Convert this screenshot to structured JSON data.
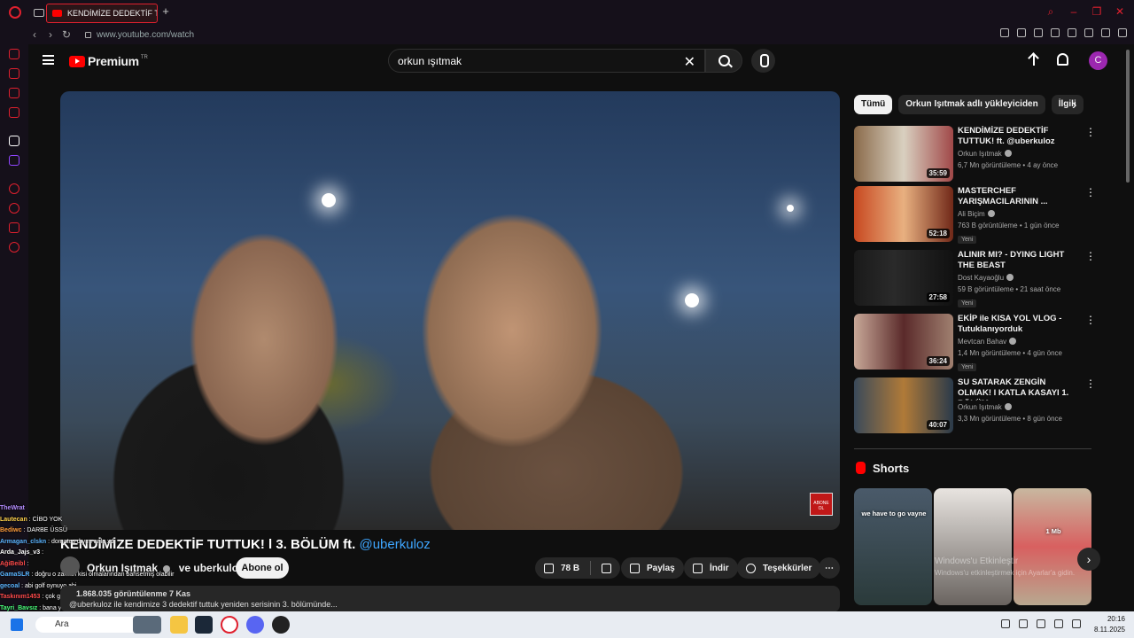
{
  "browser": {
    "tab_title": "KENDİMİZE DEDEKTİF TU",
    "url": "www.youtube.com/watch"
  },
  "header": {
    "logo_text": "Premium",
    "logo_badge": "TR",
    "search_value": "orkun ışıtmak",
    "avatar_letter": "C"
  },
  "video": {
    "title": "KENDİMİZE DEDEKTİF TUTTUK! l 3. BÖLÜM ft.",
    "title_link": "@uberkuloz",
    "channel": "Orkun Işıtmak",
    "channel_collab": "ve uberkuloz",
    "subscribe_label": "Abone ol",
    "likes": "78 B",
    "share_label": "Paylaş",
    "download_label": "İndir",
    "thanks_label": "Teşekkürler",
    "views_line": "1.868.035 görüntülenme  7 Kas",
    "description": "@uberkuloz ile kendimize 3 dedektif tuttuk yeniden serisinin 3. bölümünde..."
  },
  "chat": [
    {
      "user": "TheWrat",
      "msg": ""
    },
    {
      "user": "Lautecan",
      "msg": "CİBO YOK"
    },
    {
      "user": "Bediwc",
      "msg": "DARBE ÜSSÜ"
    },
    {
      "user": "Armagan_clskn",
      "msg": "domates dıyım anla xd"
    },
    {
      "user": "Arda_Jajs_v3",
      "msg": ""
    },
    {
      "user": "AğiBeibl",
      "msg": ""
    },
    {
      "user": "GamaSLR",
      "msg": "doğru o zaman kisi olmalarından bahsetmiş olabilir"
    },
    {
      "user": "gecoal",
      "msg": "abi golf oynuyo abi"
    },
    {
      "user": "Taskınım1453",
      "msg": "çok gülüyo"
    },
    {
      "user": "Tayri_Bavsız",
      "msg": "bana yok"
    }
  ],
  "chips": [
    "Tümü",
    "Orkun Işıtmak adlı yükleyiciden",
    "İlgili"
  ],
  "recommendations": [
    {
      "title": "KENDİMİZE DEDEKTİF TUTTUK! ft. @uberkuloz",
      "channel": "Orkun Işıtmak",
      "meta": "6,7 Mn görüntüleme • 4 ay önce",
      "duration": "35:59",
      "badge": ""
    },
    {
      "title": "MASTERCHEF YARIŞMACILARININ ...",
      "channel": "Ali Biçim",
      "meta": "763 B görüntüleme • 1 gün önce",
      "duration": "52:18",
      "badge": "Yeni"
    },
    {
      "title": "ALINIR MI? - DYING LIGHT THE BEAST",
      "channel": "Dost Kayaoğlu",
      "meta": "59 B görüntüleme • 21 saat önce",
      "duration": "27:58",
      "badge": "Yeni"
    },
    {
      "title": "EKİP ile KISA YOL VLOG - Tutuklanıyorduk",
      "channel": "Mevtcan Bahav",
      "meta": "1,4 Mn görüntüleme • 4 gün önce",
      "duration": "36:24",
      "badge": "Yeni"
    },
    {
      "title": "SU SATARAK ZENGİN OLMAK! l KATLA KASAYI 1. BÖLÜM ...",
      "channel": "Orkun Işıtmak",
      "meta": "3,3 Mn görüntüleme • 8 gün önce",
      "duration": "40:07",
      "badge": ""
    }
  ],
  "shorts": {
    "title": "Shorts",
    "items": [
      "we have to go vayne",
      "",
      "1 Mb"
    ]
  },
  "watermark": {
    "line1": "Windows'u Etkinleştir",
    "line2": "Windows'u etkinleştirmek için Ayarlar'a gidin."
  },
  "taskbar": {
    "search_placeholder": "Ara",
    "time": "20:16",
    "date": "8.11.2025"
  }
}
